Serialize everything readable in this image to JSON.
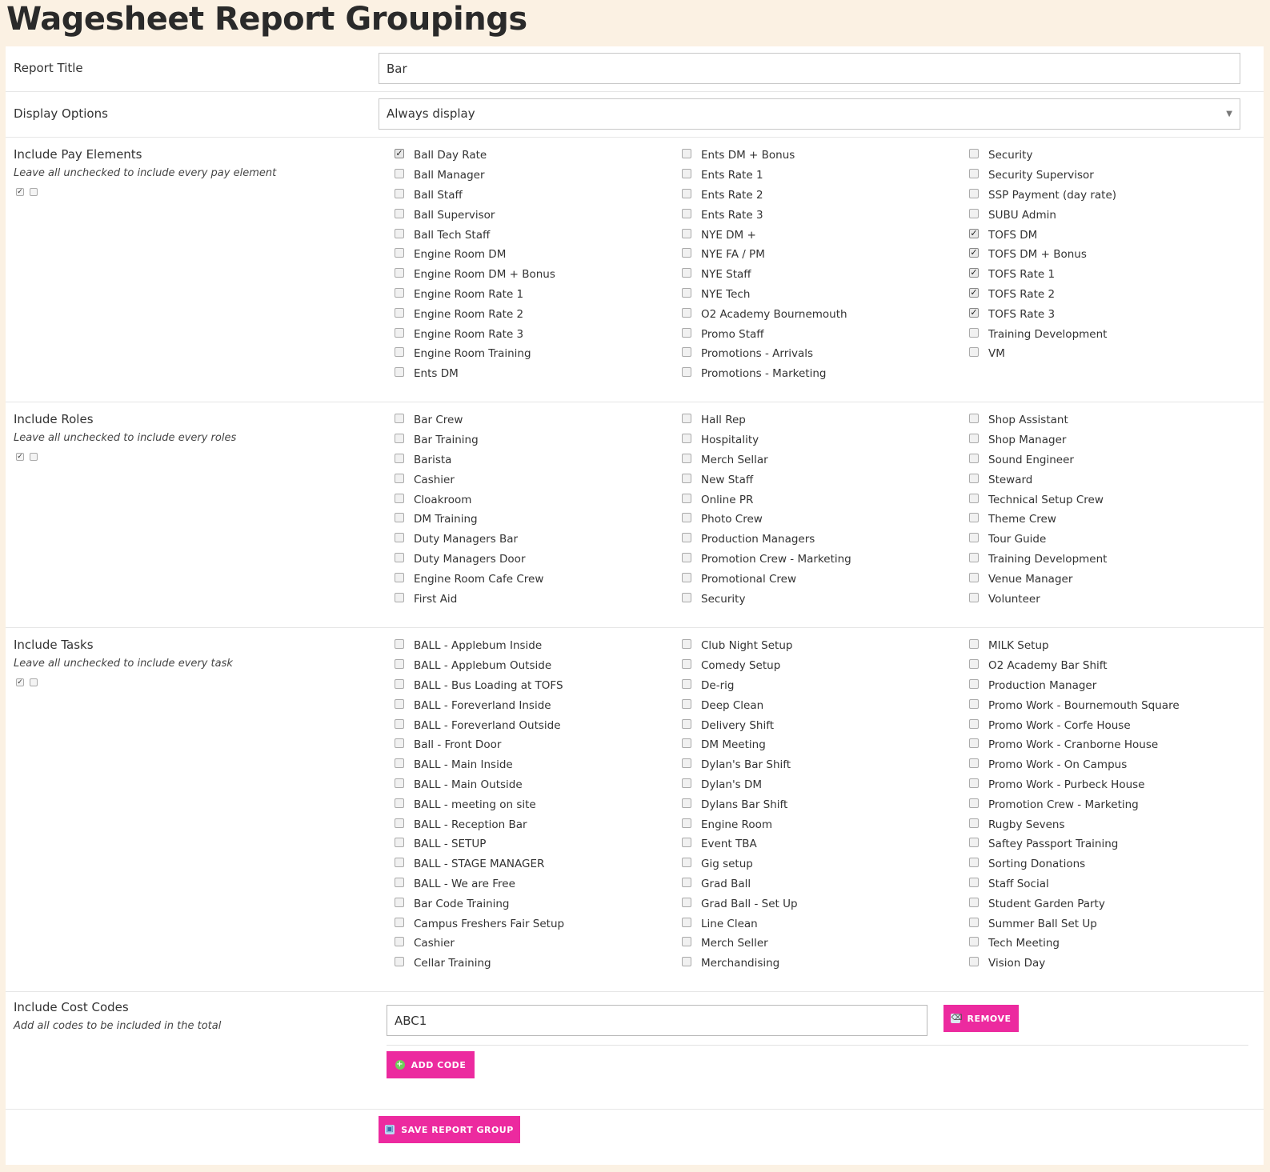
{
  "page": {
    "title": "Wagesheet Report Groupings"
  },
  "report_title": {
    "label": "Report Title",
    "value": "Bar"
  },
  "display_options": {
    "label": "Display Options",
    "value": "Always display"
  },
  "pay_elements": {
    "label": "Include Pay Elements",
    "hint": "Leave all unchecked to include every pay element",
    "columns": [
      [
        {
          "label": "Ball Day Rate",
          "checked": true
        },
        {
          "label": "Ball Manager",
          "checked": false
        },
        {
          "label": "Ball Staff",
          "checked": false
        },
        {
          "label": "Ball Supervisor",
          "checked": false
        },
        {
          "label": "Ball Tech Staff",
          "checked": false
        },
        {
          "label": "Engine Room DM",
          "checked": false
        },
        {
          "label": "Engine Room DM + Bonus",
          "checked": false
        },
        {
          "label": "Engine Room Rate 1",
          "checked": false
        },
        {
          "label": "Engine Room Rate 2",
          "checked": false
        },
        {
          "label": "Engine Room Rate 3",
          "checked": false
        },
        {
          "label": "Engine Room Training",
          "checked": false
        },
        {
          "label": "Ents DM",
          "checked": false
        }
      ],
      [
        {
          "label": "Ents DM + Bonus",
          "checked": false
        },
        {
          "label": "Ents Rate 1",
          "checked": false
        },
        {
          "label": "Ents Rate 2",
          "checked": false
        },
        {
          "label": "Ents Rate 3",
          "checked": false
        },
        {
          "label": "NYE DM +",
          "checked": false
        },
        {
          "label": "NYE FA / PM",
          "checked": false
        },
        {
          "label": "NYE Staff",
          "checked": false
        },
        {
          "label": "NYE Tech",
          "checked": false
        },
        {
          "label": "O2 Academy Bournemouth",
          "checked": false
        },
        {
          "label": "Promo Staff",
          "checked": false
        },
        {
          "label": "Promotions - Arrivals",
          "checked": false
        },
        {
          "label": "Promotions - Marketing",
          "checked": false
        }
      ],
      [
        {
          "label": "Security",
          "checked": false
        },
        {
          "label": "Security Supervisor",
          "checked": false
        },
        {
          "label": "SSP Payment (day rate)",
          "checked": false
        },
        {
          "label": "SUBU Admin",
          "checked": false
        },
        {
          "label": "TOFS DM",
          "checked": true
        },
        {
          "label": "TOFS DM + Bonus",
          "checked": true
        },
        {
          "label": "TOFS Rate 1",
          "checked": true
        },
        {
          "label": "TOFS Rate 2",
          "checked": true
        },
        {
          "label": "TOFS Rate 3",
          "checked": true
        },
        {
          "label": "Training Development",
          "checked": false
        },
        {
          "label": "VM",
          "checked": false
        }
      ]
    ]
  },
  "roles": {
    "label": "Include Roles",
    "hint": "Leave all unchecked to include every roles",
    "columns": [
      [
        {
          "label": "Bar Crew",
          "checked": false
        },
        {
          "label": "Bar Training",
          "checked": false
        },
        {
          "label": "Barista",
          "checked": false
        },
        {
          "label": "Cashier",
          "checked": false
        },
        {
          "label": "Cloakroom",
          "checked": false
        },
        {
          "label": "DM Training",
          "checked": false
        },
        {
          "label": "Duty Managers Bar",
          "checked": false
        },
        {
          "label": "Duty Managers Door",
          "checked": false
        },
        {
          "label": "Engine Room Cafe Crew",
          "checked": false
        },
        {
          "label": "First Aid",
          "checked": false
        }
      ],
      [
        {
          "label": "Hall Rep",
          "checked": false
        },
        {
          "label": "Hospitality",
          "checked": false
        },
        {
          "label": "Merch Sellar",
          "checked": false
        },
        {
          "label": "New Staff",
          "checked": false
        },
        {
          "label": "Online PR",
          "checked": false
        },
        {
          "label": "Photo Crew",
          "checked": false
        },
        {
          "label": "Production Managers",
          "checked": false
        },
        {
          "label": "Promotion Crew - Marketing",
          "checked": false
        },
        {
          "label": "Promotional Crew",
          "checked": false
        },
        {
          "label": "Security",
          "checked": false
        }
      ],
      [
        {
          "label": "Shop Assistant",
          "checked": false
        },
        {
          "label": "Shop Manager",
          "checked": false
        },
        {
          "label": "Sound Engineer",
          "checked": false
        },
        {
          "label": "Steward",
          "checked": false
        },
        {
          "label": "Technical Setup Crew",
          "checked": false
        },
        {
          "label": "Theme Crew",
          "checked": false
        },
        {
          "label": "Tour Guide",
          "checked": false
        },
        {
          "label": "Training Development",
          "checked": false
        },
        {
          "label": "Venue Manager",
          "checked": false
        },
        {
          "label": "Volunteer",
          "checked": false
        }
      ]
    ]
  },
  "tasks": {
    "label": "Include Tasks",
    "hint": "Leave all unchecked to include every task",
    "columns": [
      [
        {
          "label": "BALL - Applebum Inside",
          "checked": false
        },
        {
          "label": "BALL - Applebum Outside",
          "checked": false
        },
        {
          "label": "BALL - Bus Loading at TOFS",
          "checked": false
        },
        {
          "label": "BALL - Foreverland Inside",
          "checked": false
        },
        {
          "label": "BALL - Foreverland Outside",
          "checked": false
        },
        {
          "label": "Ball - Front Door",
          "checked": false
        },
        {
          "label": "BALL - Main Inside",
          "checked": false
        },
        {
          "label": "BALL - Main Outside",
          "checked": false
        },
        {
          "label": "BALL - meeting on site",
          "checked": false
        },
        {
          "label": "BALL - Reception Bar",
          "checked": false
        },
        {
          "label": "BALL - SETUP",
          "checked": false
        },
        {
          "label": "BALL - STAGE MANAGER",
          "checked": false
        },
        {
          "label": "BALL - We are Free",
          "checked": false
        },
        {
          "label": "Bar Code Training",
          "checked": false
        },
        {
          "label": "Campus Freshers Fair Setup",
          "checked": false
        },
        {
          "label": "Cashier",
          "checked": false
        },
        {
          "label": "Cellar Training",
          "checked": false
        }
      ],
      [
        {
          "label": "Club Night Setup",
          "checked": false
        },
        {
          "label": "Comedy Setup",
          "checked": false
        },
        {
          "label": "De-rig",
          "checked": false
        },
        {
          "label": "Deep Clean",
          "checked": false
        },
        {
          "label": "Delivery Shift",
          "checked": false
        },
        {
          "label": "DM Meeting",
          "checked": false
        },
        {
          "label": "Dylan's Bar Shift",
          "checked": false
        },
        {
          "label": "Dylan's DM",
          "checked": false
        },
        {
          "label": "Dylans Bar Shift",
          "checked": false
        },
        {
          "label": "Engine Room",
          "checked": false
        },
        {
          "label": "Event TBA",
          "checked": false
        },
        {
          "label": "Gig setup",
          "checked": false
        },
        {
          "label": "Grad Ball",
          "checked": false
        },
        {
          "label": "Grad Ball - Set Up",
          "checked": false
        },
        {
          "label": "Line Clean",
          "checked": false
        },
        {
          "label": "Merch Seller",
          "checked": false
        },
        {
          "label": "Merchandising",
          "checked": false
        }
      ],
      [
        {
          "label": "MILK Setup",
          "checked": false
        },
        {
          "label": "O2 Academy Bar Shift",
          "checked": false
        },
        {
          "label": "Production Manager",
          "checked": false
        },
        {
          "label": "Promo Work - Bournemouth Square",
          "checked": false
        },
        {
          "label": "Promo Work - Corfe House",
          "checked": false
        },
        {
          "label": "Promo Work - Cranborne House",
          "checked": false
        },
        {
          "label": "Promo Work - On Campus",
          "checked": false
        },
        {
          "label": "Promo Work - Purbeck House",
          "checked": false
        },
        {
          "label": "Promotion Crew - Marketing",
          "checked": false
        },
        {
          "label": "Rugby Sevens",
          "checked": false
        },
        {
          "label": "Saftey Passport Training",
          "checked": false
        },
        {
          "label": "Sorting Donations",
          "checked": false
        },
        {
          "label": "Staff Social",
          "checked": false
        },
        {
          "label": "Student Garden Party",
          "checked": false
        },
        {
          "label": "Summer Ball Set Up",
          "checked": false
        },
        {
          "label": "Tech Meeting",
          "checked": false
        },
        {
          "label": "Vision Day",
          "checked": false
        }
      ]
    ]
  },
  "cost_codes": {
    "label": "Include Cost Codes",
    "hint": "Add all codes to be included in the total",
    "value": "ABC1",
    "remove_label": "REMOVE",
    "add_label": "ADD CODE"
  },
  "save_label": "SAVE REPORT GROUP",
  "colors": {
    "accent": "#ec2a9f",
    "page_bg": "#fbf1e3"
  }
}
